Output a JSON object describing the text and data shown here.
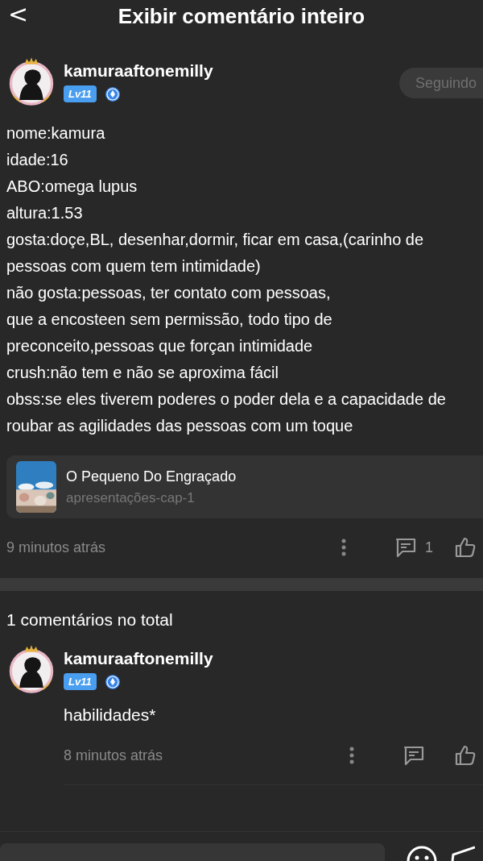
{
  "header": {
    "back_icon": "<",
    "title": "Exibir comentário inteiro"
  },
  "post": {
    "author": {
      "name": "kamuraaftonemilly",
      "level": "Lv11"
    },
    "follow_button": {
      "label": "Seguindo",
      "selected": true
    },
    "lines": [
      "nome:kamura",
      "idade:16",
      "ABO:omega lupus",
      "altura:1.53",
      "gosta:doçe,BL, desenhar,dormir, ficar em casa,(carinho de pessoas com quem tem intimidade)",
      "não gosta:pessoas, ter contato com pessoas,",
      "que a encosteen sem permissão, todo tipo de",
      "preconceito,pessoas que forçan intimidade",
      "crush:não tem e não se aproxima fácil",
      "obss:se eles tiverem poderes o poder dela e a capacidade de roubar as agilidades das pessoas com um toque"
    ],
    "link_card": {
      "title": "O Pequeno Do Engraçado",
      "subtitle": "apresentações-cap-1"
    },
    "time": "9 minutos atrás",
    "reply_count": "1"
  },
  "comments_total": "1 comentários no total",
  "comments": [
    {
      "author": {
        "name": "kamuraaftonemilly",
        "level": "Lv11"
      },
      "text": "habilidades*",
      "time": "8 minutos atrás"
    }
  ]
}
